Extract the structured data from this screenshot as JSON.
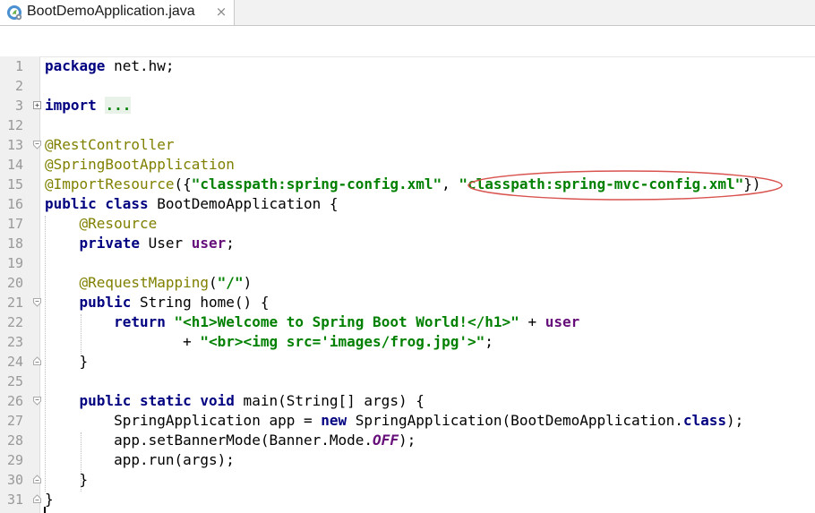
{
  "tab": {
    "title": "BootDemoApplication.java",
    "close_glyph": "×",
    "icon": "spring-class-icon"
  },
  "editor": {
    "lines": [
      {
        "n": "1",
        "tokens": [
          {
            "t": "package",
            "c": "kw"
          },
          {
            "t": " net.hw;",
            "c": ""
          }
        ]
      },
      {
        "n": "2",
        "tokens": []
      },
      {
        "n": "3",
        "fold": "plus",
        "tokens": [
          {
            "t": "import",
            "c": "kw"
          },
          {
            "t": " ",
            "c": ""
          },
          {
            "t": "...",
            "c": "fold-dots"
          }
        ]
      },
      {
        "n": "12",
        "tokens": []
      },
      {
        "n": "13",
        "fold": "open",
        "tokens": [
          {
            "t": "@RestController",
            "c": "ann"
          }
        ]
      },
      {
        "n": "14",
        "tokens": [
          {
            "t": "@SpringBootApplication",
            "c": "ann"
          }
        ]
      },
      {
        "n": "15",
        "tokens": [
          {
            "t": "@ImportResource",
            "c": "ann"
          },
          {
            "t": "({",
            "c": ""
          },
          {
            "t": "\"classpath:spring-config.xml\"",
            "c": "str"
          },
          {
            "t": ", ",
            "c": ""
          },
          {
            "t": "\"classpath:spring-mvc-config.xml\"",
            "c": "str"
          },
          {
            "t": "})",
            "c": ""
          }
        ]
      },
      {
        "n": "16",
        "tokens": [
          {
            "t": "public class",
            "c": "kw"
          },
          {
            "t": " BootDemoApplication {",
            "c": ""
          }
        ]
      },
      {
        "n": "17",
        "tokens": [
          {
            "t": "    ",
            "c": ""
          },
          {
            "t": "@Resource",
            "c": "ann"
          }
        ]
      },
      {
        "n": "18",
        "tokens": [
          {
            "t": "    ",
            "c": ""
          },
          {
            "t": "private",
            "c": "kw"
          },
          {
            "t": " User ",
            "c": ""
          },
          {
            "t": "user",
            "c": "fld"
          },
          {
            "t": ";",
            "c": ""
          }
        ]
      },
      {
        "n": "19",
        "tokens": []
      },
      {
        "n": "20",
        "tokens": [
          {
            "t": "    ",
            "c": ""
          },
          {
            "t": "@RequestMapping",
            "c": "ann"
          },
          {
            "t": "(",
            "c": ""
          },
          {
            "t": "\"/\"",
            "c": "str"
          },
          {
            "t": ")",
            "c": ""
          }
        ]
      },
      {
        "n": "21",
        "fold": "open",
        "tokens": [
          {
            "t": "    ",
            "c": ""
          },
          {
            "t": "public",
            "c": "kw"
          },
          {
            "t": " String home() {",
            "c": ""
          }
        ]
      },
      {
        "n": "22",
        "tokens": [
          {
            "t": "        ",
            "c": ""
          },
          {
            "t": "return",
            "c": "kw"
          },
          {
            "t": " ",
            "c": ""
          },
          {
            "t": "\"<h1>Welcome to Spring Boot World!</h1>\"",
            "c": "str"
          },
          {
            "t": " + ",
            "c": ""
          },
          {
            "t": "user",
            "c": "fld"
          }
        ]
      },
      {
        "n": "23",
        "tokens": [
          {
            "t": "                + ",
            "c": ""
          },
          {
            "t": "\"<br><img src='images/frog.jpg'>\"",
            "c": "str"
          },
          {
            "t": ";",
            "c": ""
          }
        ]
      },
      {
        "n": "24",
        "fold": "close",
        "tokens": [
          {
            "t": "    }",
            "c": ""
          }
        ]
      },
      {
        "n": "25",
        "tokens": []
      },
      {
        "n": "26",
        "fold": "open",
        "tokens": [
          {
            "t": "    ",
            "c": ""
          },
          {
            "t": "public static void",
            "c": "kw"
          },
          {
            "t": " main(String[] args) {",
            "c": ""
          }
        ]
      },
      {
        "n": "27",
        "tokens": [
          {
            "t": "        SpringApplication app = ",
            "c": ""
          },
          {
            "t": "new",
            "c": "kw"
          },
          {
            "t": " SpringApplication(BootDemoApplication.",
            "c": ""
          },
          {
            "t": "class",
            "c": "kw"
          },
          {
            "t": ");",
            "c": ""
          }
        ]
      },
      {
        "n": "28",
        "tokens": [
          {
            "t": "        app.setBannerMode(Banner.Mode.",
            "c": ""
          },
          {
            "t": "OFF",
            "c": "cst"
          },
          {
            "t": ");",
            "c": ""
          }
        ]
      },
      {
        "n": "29",
        "tokens": [
          {
            "t": "        app.run(args);",
            "c": ""
          }
        ]
      },
      {
        "n": "30",
        "fold": "close",
        "tokens": [
          {
            "t": "    }",
            "c": ""
          }
        ]
      },
      {
        "n": "31",
        "fold": "close",
        "tokens": [
          {
            "t": "}",
            "c": ""
          }
        ]
      }
    ]
  },
  "colors": {
    "keyword": "#000080",
    "string": "#008000",
    "annotation": "#808000",
    "field": "#660e7a",
    "highlight_oval": "#d9534f"
  }
}
